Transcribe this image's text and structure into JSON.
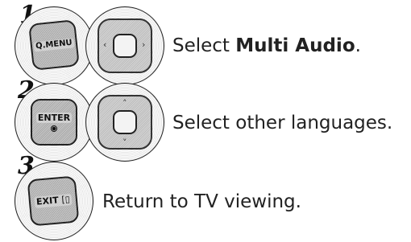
{
  "steps": [
    {
      "number": "1",
      "key_label": "Q.MENU",
      "nav": "left-right",
      "text_prefix": "Select ",
      "text_bold": "Multi Audio",
      "text_suffix": "."
    },
    {
      "number": "2",
      "key_label": "ENTER",
      "nav": "up-down",
      "text": "Select other languages."
    },
    {
      "number": "3",
      "key_label": "EXIT",
      "text": "Return to TV viewing."
    }
  ],
  "icons": {
    "left_arrow": "‹",
    "right_arrow": "›",
    "up_arrow": "˄",
    "down_arrow": "˅",
    "exit_glyph": "[▯"
  }
}
